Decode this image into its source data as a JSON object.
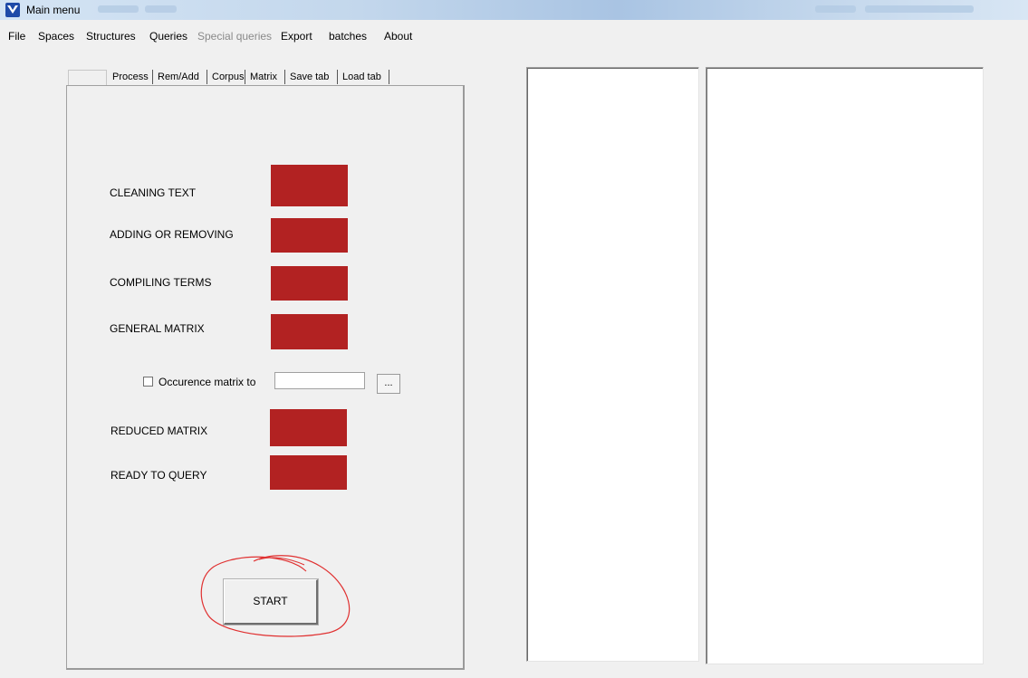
{
  "window": {
    "title": "Main menu",
    "title_right_blurred": "Word document window title (blurred)"
  },
  "menu": [
    {
      "label": "File",
      "enabled": true
    },
    {
      "label": "Spaces",
      "enabled": true
    },
    {
      "label": "Structures",
      "enabled": true
    },
    {
      "label": "Queries",
      "enabled": true
    },
    {
      "label": "Special queries",
      "enabled": false
    },
    {
      "label": "Export",
      "enabled": true
    },
    {
      "label": "batches",
      "enabled": true
    },
    {
      "label": "About",
      "enabled": true
    }
  ],
  "tabs": [
    {
      "label": "Process",
      "selected": true
    },
    {
      "label": "Rem/Add",
      "selected": false
    },
    {
      "label": "Corpus",
      "selected": false
    },
    {
      "label": "Matrix",
      "selected": false
    },
    {
      "label": "Save tab",
      "selected": false
    },
    {
      "label": "Load tab",
      "selected": false
    }
  ],
  "process": {
    "steps": [
      {
        "label": "CLEANING TEXT",
        "status_color": "#b22222"
      },
      {
        "label": "ADDING OR REMOVING",
        "status_color": "#b22222"
      },
      {
        "label": "COMPILING TERMS",
        "status_color": "#b22222"
      },
      {
        "label": "GENERAL MATRIX",
        "status_color": "#b22222"
      },
      {
        "label": "REDUCED MATRIX",
        "status_color": "#b22222"
      },
      {
        "label": "READY TO QUERY",
        "status_color": "#b22222"
      }
    ],
    "occurrence": {
      "checkbox_label": "Occurence matrix to",
      "checked": false,
      "path_value": "",
      "browse_label": "..."
    },
    "start_label": "START"
  },
  "colors": {
    "status_red": "#b22222",
    "annotation_circle": "#e03030"
  }
}
